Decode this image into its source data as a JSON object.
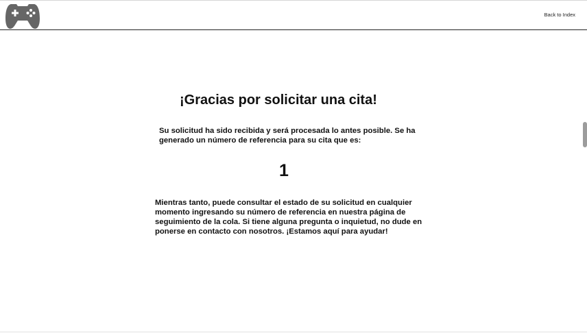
{
  "header": {
    "logo_icon": "gamepad-icon",
    "back_link_label": "Back to Index"
  },
  "main": {
    "title": "¡Gracias por solicitar una cita!",
    "intro": "Su solicitud ha sido recibida y será procesada lo antes posible. Se ha generado un número de referencia para su cita que es:",
    "reference_number": "1",
    "details": "Mientras tanto, puede consultar el estado de su solicitud en cualquier momento ingresando su número de referencia en nuestra página de seguimiento de la cola. Si tiene alguna pregunta o inquietud, no dude en ponerse en contacto con nosotros. ¡Estamos aquí para ayudar!"
  },
  "colors": {
    "text": "#111111",
    "logo": "#666666",
    "header_border": "#222222",
    "scrollbar_thumb": "#9c9c9c"
  }
}
